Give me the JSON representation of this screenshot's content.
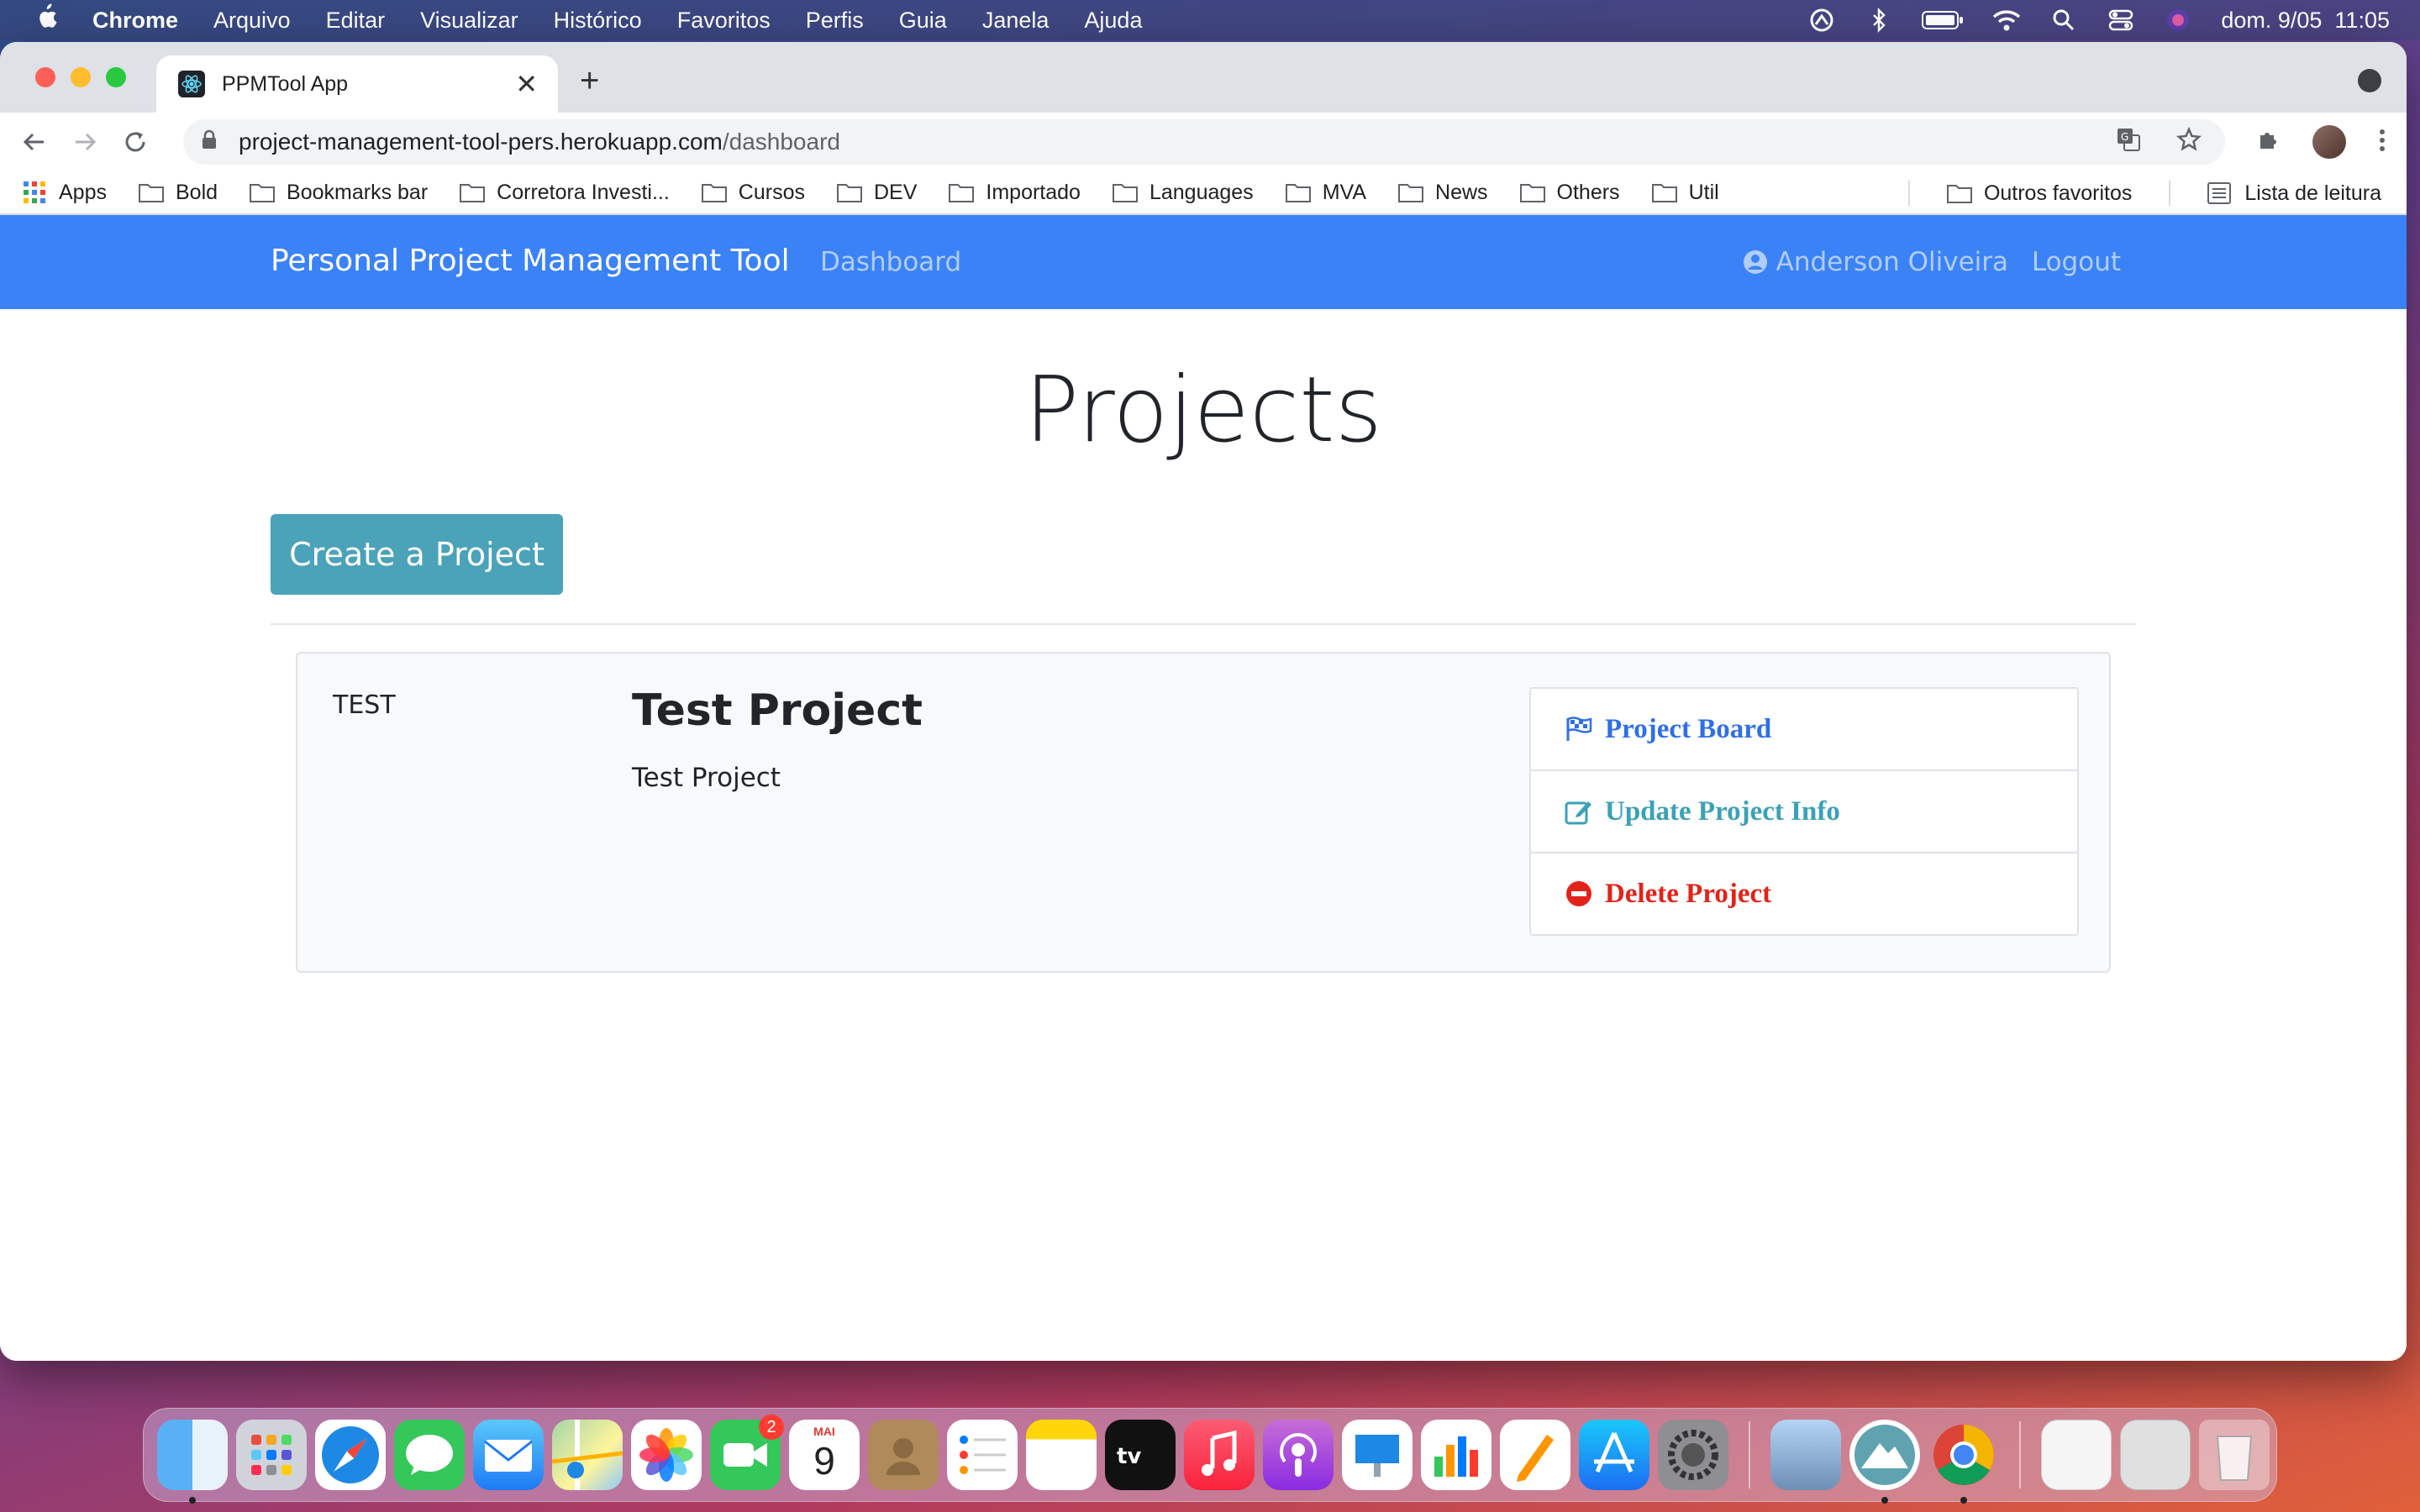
{
  "menubar": {
    "app_name": "Chrome",
    "items": [
      "Arquivo",
      "Editar",
      "Visualizar",
      "Histórico",
      "Favoritos",
      "Perfis",
      "Guia",
      "Janela",
      "Ajuda"
    ],
    "datetime": "dom. 9/05  11:05"
  },
  "browser": {
    "tab_title": "PPMTool App",
    "url_host": "project-management-tool-pers.herokuapp.com",
    "url_path": "/dashboard",
    "bookmarks": [
      "Apps",
      "Bold",
      "Bookmarks bar",
      "Corretora Investi...",
      "Cursos",
      "DEV",
      "Importado",
      "Languages",
      "MVA",
      "News",
      "Others",
      "Util"
    ],
    "other_bookmarks": "Outros favoritos",
    "reading_list": "Lista de leitura"
  },
  "app": {
    "brand": "Personal Project Management Tool",
    "nav_dashboard": "Dashboard",
    "user_name": "Anderson Oliveira",
    "logout": "Logout",
    "page_title": "Projects",
    "create_button": "Create a Project",
    "projects": [
      {
        "identifier": "TEST",
        "name": "Test Project",
        "description": "Test Project",
        "actions": {
          "board": "Project Board",
          "update": "Update Project Info",
          "delete": "Delete Project"
        }
      }
    ],
    "colors": {
      "navbar": "#3b82f6",
      "create_button": "#4aa3b8",
      "board_link": "#2f6fe4",
      "update_link": "#3ba1b6",
      "delete_link": "#e2231a"
    }
  },
  "dock": {
    "facetime_badge": "2",
    "calendar_month": "MAI",
    "calendar_day": "9"
  }
}
